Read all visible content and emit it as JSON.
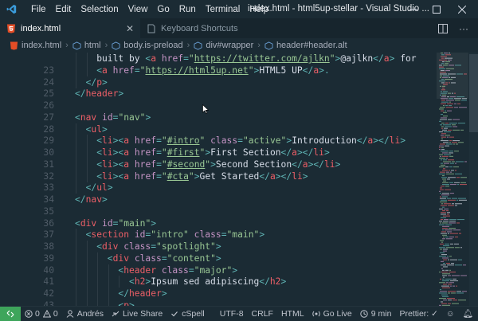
{
  "menu": [
    "File",
    "Edit",
    "Selection",
    "View",
    "Go",
    "Run",
    "Terminal",
    "Help"
  ],
  "window_title": "index.html - html5up-stellar - Visual Studio ...",
  "tabs": [
    {
      "label": "index.html",
      "icon": "html5-icon",
      "active": true
    },
    {
      "label": "Keyboard Shortcuts",
      "icon": "keyboard-shortcuts-icon",
      "active": false
    }
  ],
  "breadcrumb": [
    "index.html",
    "html",
    "body.is-preload",
    "div#wrapper",
    "header#header.alt"
  ],
  "code_lines": [
    {
      "n": "",
      "indent": 2,
      "tokens": [
        [
          "t",
          "built by "
        ],
        [
          "p",
          "<"
        ],
        [
          "g",
          "a"
        ],
        [
          "p",
          " "
        ],
        [
          "a",
          "href"
        ],
        [
          "p",
          "="
        ],
        [
          "s",
          "\""
        ],
        [
          "u",
          "https://twitter.com/ajlkn"
        ],
        [
          "s",
          "\""
        ],
        [
          "p",
          ">"
        ],
        [
          "t",
          "@ajlkn"
        ],
        [
          "p",
          "</"
        ],
        [
          "g",
          "a"
        ],
        [
          "p",
          "> "
        ],
        [
          "t",
          "for"
        ]
      ]
    },
    {
      "n": "23",
      "indent": 2,
      "tokens": [
        [
          "p",
          "<"
        ],
        [
          "g",
          "a"
        ],
        [
          "p",
          " "
        ],
        [
          "a",
          "href"
        ],
        [
          "p",
          "="
        ],
        [
          "s",
          "\""
        ],
        [
          "u",
          "https://html5up.net"
        ],
        [
          "s",
          "\""
        ],
        [
          "p",
          ">"
        ],
        [
          "t",
          "HTML5 UP"
        ],
        [
          "p",
          "</"
        ],
        [
          "g",
          "a"
        ],
        [
          "p",
          ">."
        ]
      ]
    },
    {
      "n": "24",
      "indent": 1,
      "tokens": [
        [
          "p",
          "</"
        ],
        [
          "g",
          "p"
        ],
        [
          "p",
          ">"
        ]
      ]
    },
    {
      "n": "25",
      "indent": 0,
      "tokens": [
        [
          "p",
          "</"
        ],
        [
          "g",
          "header"
        ],
        [
          "p",
          ">"
        ]
      ]
    },
    {
      "n": "26",
      "indent": 0,
      "tokens": []
    },
    {
      "n": "27",
      "indent": 0,
      "tokens": [
        [
          "p",
          "<"
        ],
        [
          "g",
          "nav"
        ],
        [
          "p",
          " "
        ],
        [
          "a",
          "id"
        ],
        [
          "p",
          "="
        ],
        [
          "s",
          "\"nav\""
        ],
        [
          "p",
          ">"
        ]
      ]
    },
    {
      "n": "28",
      "indent": 1,
      "tokens": [
        [
          "p",
          "<"
        ],
        [
          "g",
          "ul"
        ],
        [
          "p",
          ">"
        ]
      ]
    },
    {
      "n": "29",
      "indent": 2,
      "tokens": [
        [
          "p",
          "<"
        ],
        [
          "g",
          "li"
        ],
        [
          "p",
          "><"
        ],
        [
          "g",
          "a"
        ],
        [
          "p",
          " "
        ],
        [
          "a",
          "href"
        ],
        [
          "p",
          "="
        ],
        [
          "s",
          "\""
        ],
        [
          "u",
          "#intro"
        ],
        [
          "s",
          "\""
        ],
        [
          "p",
          " "
        ],
        [
          "a",
          "class"
        ],
        [
          "p",
          "="
        ],
        [
          "s",
          "\"active\""
        ],
        [
          "p",
          ">"
        ],
        [
          "t",
          "Introduction"
        ],
        [
          "p",
          "</"
        ],
        [
          "g",
          "a"
        ],
        [
          "p",
          "></"
        ],
        [
          "g",
          "li"
        ],
        [
          "p",
          ">"
        ]
      ]
    },
    {
      "n": "30",
      "indent": 2,
      "tokens": [
        [
          "p",
          "<"
        ],
        [
          "g",
          "li"
        ],
        [
          "p",
          "><"
        ],
        [
          "g",
          "a"
        ],
        [
          "p",
          " "
        ],
        [
          "a",
          "href"
        ],
        [
          "p",
          "="
        ],
        [
          "s",
          "\""
        ],
        [
          "u",
          "#first"
        ],
        [
          "s",
          "\""
        ],
        [
          "p",
          ">"
        ],
        [
          "t",
          "First Section"
        ],
        [
          "p",
          "</"
        ],
        [
          "g",
          "a"
        ],
        [
          "p",
          "></"
        ],
        [
          "g",
          "li"
        ],
        [
          "p",
          ">"
        ]
      ]
    },
    {
      "n": "31",
      "indent": 2,
      "tokens": [
        [
          "p",
          "<"
        ],
        [
          "g",
          "li"
        ],
        [
          "p",
          "><"
        ],
        [
          "g",
          "a"
        ],
        [
          "p",
          " "
        ],
        [
          "a",
          "href"
        ],
        [
          "p",
          "="
        ],
        [
          "s",
          "\""
        ],
        [
          "u",
          "#second"
        ],
        [
          "s",
          "\""
        ],
        [
          "p",
          ">"
        ],
        [
          "t",
          "Second Section"
        ],
        [
          "p",
          "</"
        ],
        [
          "g",
          "a"
        ],
        [
          "p",
          "></"
        ],
        [
          "g",
          "li"
        ],
        [
          "p",
          ">"
        ]
      ]
    },
    {
      "n": "32",
      "indent": 2,
      "tokens": [
        [
          "p",
          "<"
        ],
        [
          "g",
          "li"
        ],
        [
          "p",
          "><"
        ],
        [
          "g",
          "a"
        ],
        [
          "p",
          " "
        ],
        [
          "a",
          "href"
        ],
        [
          "p",
          "="
        ],
        [
          "s",
          "\""
        ],
        [
          "u",
          "#cta"
        ],
        [
          "s",
          "\""
        ],
        [
          "p",
          ">"
        ],
        [
          "t",
          "Get Started"
        ],
        [
          "p",
          "</"
        ],
        [
          "g",
          "a"
        ],
        [
          "p",
          "></"
        ],
        [
          "g",
          "li"
        ],
        [
          "p",
          ">"
        ]
      ]
    },
    {
      "n": "33",
      "indent": 1,
      "tokens": [
        [
          "p",
          "</"
        ],
        [
          "g",
          "ul"
        ],
        [
          "p",
          ">"
        ]
      ]
    },
    {
      "n": "34",
      "indent": 0,
      "tokens": [
        [
          "p",
          "</"
        ],
        [
          "g",
          "nav"
        ],
        [
          "p",
          ">"
        ]
      ]
    },
    {
      "n": "35",
      "indent": 0,
      "tokens": []
    },
    {
      "n": "36",
      "indent": 0,
      "tokens": [
        [
          "p",
          "<"
        ],
        [
          "g",
          "div"
        ],
        [
          "p",
          " "
        ],
        [
          "a",
          "id"
        ],
        [
          "p",
          "="
        ],
        [
          "s",
          "\"main\""
        ],
        [
          "p",
          ">"
        ]
      ]
    },
    {
      "n": "37",
      "indent": 1,
      "tokens": [
        [
          "p",
          "<"
        ],
        [
          "g",
          "section"
        ],
        [
          "p",
          " "
        ],
        [
          "a",
          "id"
        ],
        [
          "p",
          "="
        ],
        [
          "s",
          "\"intro\""
        ],
        [
          "p",
          " "
        ],
        [
          "a",
          "class"
        ],
        [
          "p",
          "="
        ],
        [
          "s",
          "\"main\""
        ],
        [
          "p",
          ">"
        ]
      ]
    },
    {
      "n": "38",
      "indent": 2,
      "tokens": [
        [
          "p",
          "<"
        ],
        [
          "g",
          "div"
        ],
        [
          "p",
          " "
        ],
        [
          "a",
          "class"
        ],
        [
          "p",
          "="
        ],
        [
          "s",
          "\"spotlight\""
        ],
        [
          "p",
          ">"
        ]
      ]
    },
    {
      "n": "39",
      "indent": 3,
      "tokens": [
        [
          "p",
          "<"
        ],
        [
          "g",
          "div"
        ],
        [
          "p",
          " "
        ],
        [
          "a",
          "class"
        ],
        [
          "p",
          "="
        ],
        [
          "s",
          "\"content\""
        ],
        [
          "p",
          ">"
        ]
      ]
    },
    {
      "n": "40",
      "indent": 4,
      "tokens": [
        [
          "p",
          "<"
        ],
        [
          "g",
          "header"
        ],
        [
          "p",
          " "
        ],
        [
          "a",
          "class"
        ],
        [
          "p",
          "="
        ],
        [
          "s",
          "\"major\""
        ],
        [
          "p",
          ">"
        ]
      ]
    },
    {
      "n": "41",
      "indent": 5,
      "tokens": [
        [
          "p",
          "<"
        ],
        [
          "g",
          "h2"
        ],
        [
          "p",
          ">"
        ],
        [
          "t",
          "Ipsum sed adipiscing"
        ],
        [
          "p",
          "</"
        ],
        [
          "g",
          "h2"
        ],
        [
          "p",
          ">"
        ]
      ]
    },
    {
      "n": "42",
      "indent": 4,
      "tokens": [
        [
          "p",
          "</"
        ],
        [
          "g",
          "header"
        ],
        [
          "p",
          ">"
        ]
      ]
    },
    {
      "n": "43",
      "indent": 4,
      "tokens": [
        [
          "p",
          "<"
        ],
        [
          "g",
          "p"
        ],
        [
          "p",
          ">"
        ]
      ]
    }
  ],
  "status": {
    "errors": "0",
    "warnings": "0",
    "user": "Andrés",
    "live_share": "Live Share",
    "cspell": "cSpell",
    "encoding": "UTF-8",
    "eol": "CRLF",
    "language": "HTML",
    "go_live": "Go Live",
    "time": "9 min",
    "prettier": "Prettier: ✓"
  },
  "colors": {
    "background": "#1b2b34",
    "tag": "#ec5f67",
    "attribute": "#c594c5",
    "string": "#99c794",
    "punctuation": "#5fb3b3",
    "remote": "#3ea55b"
  }
}
